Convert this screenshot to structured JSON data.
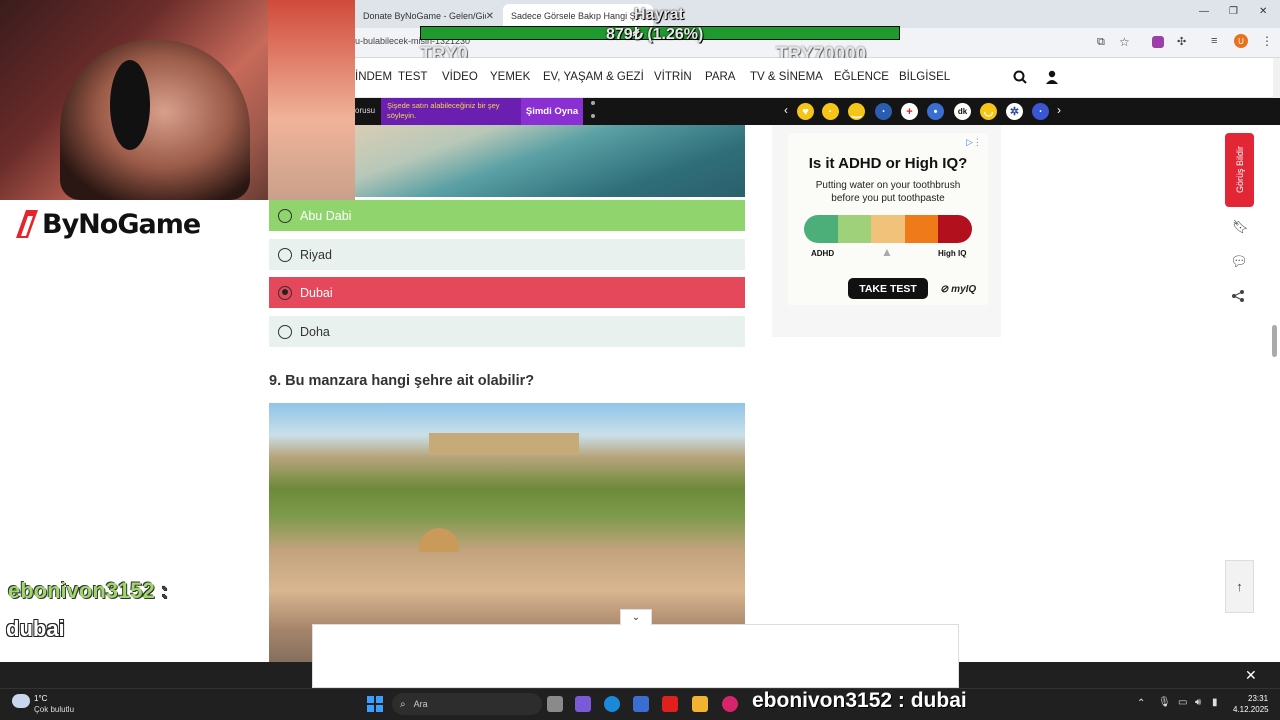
{
  "browser": {
    "tabs": [
      {
        "label": "Donate ByNoGame - Gelen/Giden"
      },
      {
        "label": "Sadece Görsele Bakıp Hangi Şe..."
      }
    ],
    "url_fragment": "u-bulabilecek-misin-1321230"
  },
  "donation": {
    "title": "Hayrat",
    "amount": "879₺ (1.26%)",
    "min_label": "TRY0",
    "max_label": "TRY70000",
    "progress_fraction": 0.0126
  },
  "nav": {
    "items": [
      "İNDEM",
      "TEST",
      "VİDEO",
      "YEMEK",
      "EV, YAŞAM & GEZİ",
      "VİTRİN",
      "PARA",
      "TV & SİNEMA",
      "EĞLENCE",
      "BİLGİSEL"
    ]
  },
  "promo": {
    "left_text": "orusu",
    "banner_text": "Şişede satın alabileceğiniz bir şey söyleyin.",
    "play_label": "Şimdi Oyna"
  },
  "brand": {
    "logo_text": "ByNoGame"
  },
  "quiz": {
    "options": [
      {
        "label": "Abu Dabi",
        "state": "correct"
      },
      {
        "label": "Riyad",
        "state": "neutral"
      },
      {
        "label": "Dubai",
        "state": "wrong-selected"
      },
      {
        "label": "Doha",
        "state": "neutral"
      }
    ],
    "next_question": "9. Bu manzara hangi şehre ait olabilir?"
  },
  "ad": {
    "headline": "Is it ADHD or High IQ?",
    "body": "Putting water on your toothbrush before you put toothpaste",
    "scale_left": "ADHD",
    "scale_right": "High IQ",
    "cta": "TAKE TEST",
    "brand": "myIQ",
    "scale_colors": [
      "#4caf7a",
      "#9fd07a",
      "#f0c27a",
      "#ef7a1a",
      "#b3101e"
    ]
  },
  "side_tools": {
    "feedback_label": "Görüş Bildir"
  },
  "chat": {
    "username": "ebonivon3152",
    "separator": ":",
    "message": "dubai",
    "ticker": "ebonivon3152 : dubai"
  },
  "taskbar": {
    "weather_temp": "1°C",
    "weather_desc": "Çok bulutlu",
    "search_placeholder": "Ara",
    "time": "23:31",
    "date": "4.12.2025"
  },
  "colors": {
    "correct": "#8fd46d",
    "wrong": "#e5475b",
    "neutral": "#e8f1ee",
    "feedback": "#e32636"
  }
}
